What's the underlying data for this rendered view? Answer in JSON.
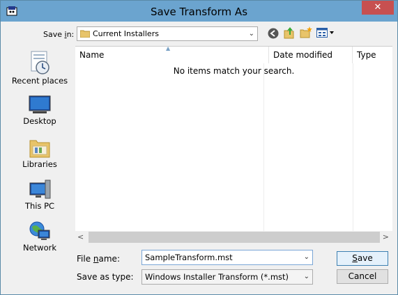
{
  "window": {
    "title": "Save Transform As",
    "close_glyph": "✕",
    "app_icon": "app-icon"
  },
  "toolbar": {
    "save_in_label_prefix": "Save ",
    "save_in_label_accel": "i",
    "save_in_label_suffix": "n:",
    "save_in_value": "Current Installers",
    "icons": [
      "back-icon",
      "up-folder-icon",
      "new-folder-icon",
      "view-menu-icon"
    ]
  },
  "places": [
    {
      "label": "Recent places",
      "icon": "recent-places-icon"
    },
    {
      "label": "Desktop",
      "icon": "desktop-icon"
    },
    {
      "label": "Libraries",
      "icon": "libraries-icon"
    },
    {
      "label": "This PC",
      "icon": "this-pc-icon"
    },
    {
      "label": "Network",
      "icon": "network-icon"
    }
  ],
  "filelist": {
    "columns": [
      "Name",
      "Date modified",
      "Type"
    ],
    "empty_message": "No items match your search."
  },
  "bottom": {
    "file_name_label_prefix": "File ",
    "file_name_label_accel": "n",
    "file_name_label_suffix": "ame:",
    "file_name_value": "SampleTransform.mst",
    "save_as_type_label": "Save as type:",
    "save_as_type_value": "Windows Installer Transform (*.mst)"
  },
  "buttons": {
    "save_accel": "S",
    "save_rest": "ave",
    "cancel": "Cancel"
  },
  "colors": {
    "titlebar": "#6ba4cf",
    "close": "#c75050",
    "accent_border": "#3c7fb1"
  }
}
